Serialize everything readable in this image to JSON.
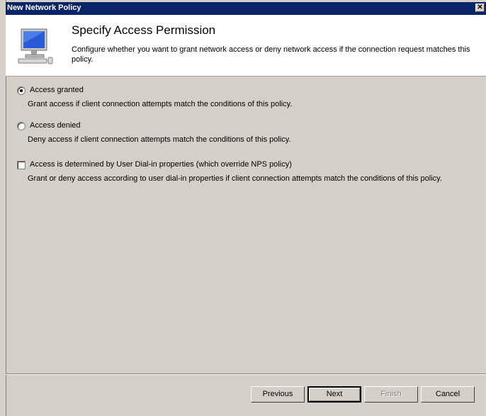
{
  "window": {
    "title": "New Network Policy",
    "close_symbol": "✕"
  },
  "header": {
    "title": "Specify Access Permission",
    "description": "Configure whether you want to grant network access or deny network access if the connection request matches this policy."
  },
  "options": [
    {
      "label": "Access granted",
      "description": "Grant access if client connection attempts match the conditions of this policy.",
      "checked": true
    },
    {
      "label": "Access denied",
      "description": "Deny access if client connection attempts match the conditions of this policy.",
      "checked": false
    },
    {
      "label": "Access is determined by User Dial-in properties (which override NPS policy)",
      "description": "Grant or deny access according to user dial-in properties if client connection attempts match the conditions of this policy.",
      "checked": false
    }
  ],
  "buttons": {
    "previous": "Previous",
    "next": "Next",
    "finish": "Finish",
    "cancel": "Cancel"
  },
  "colors": {
    "titlebar": "#0a246a",
    "face": "#d4d0c8",
    "header_bg": "#ffffff"
  }
}
